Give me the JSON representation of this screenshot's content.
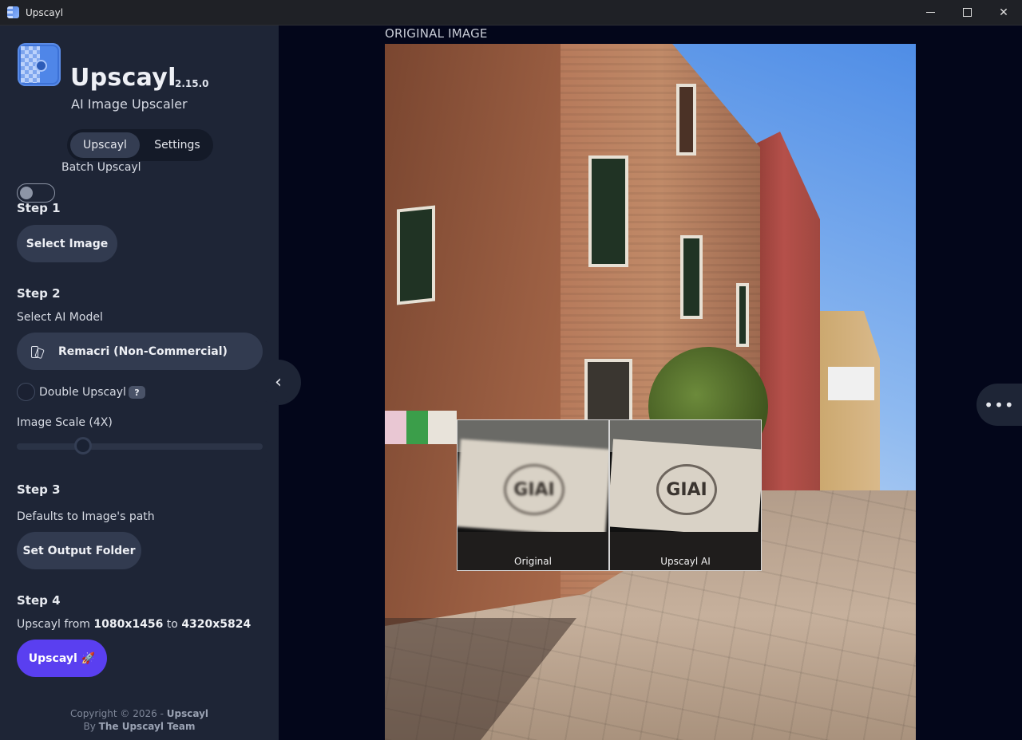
{
  "window": {
    "title": "Upscayl",
    "minimize_icon": "minimize-icon",
    "maximize_icon": "maximize-icon",
    "close_icon": "close-icon"
  },
  "sidebar": {
    "app_name": "Upscayl",
    "version": "2.15.0",
    "tagline": "AI Image Upscaler",
    "tabs": [
      {
        "label": "Upscayl",
        "active": true
      },
      {
        "label": "Settings",
        "active": false
      }
    ],
    "batch": {
      "label": "Batch Upscayl",
      "enabled": false
    },
    "step1": {
      "title": "Step 1",
      "button": "Select Image"
    },
    "step2": {
      "title": "Step 2",
      "model_label": "Select AI Model",
      "model_value": "Remacri (Non-Commercial)",
      "double_upscayl": {
        "label": "Double Upscayl",
        "help": "?",
        "checked": false
      },
      "scale_label": "Image Scale (4X)",
      "scale_fraction": 0.25
    },
    "step3": {
      "title": "Step 3",
      "description": "Defaults to Image's path",
      "button": "Set Output Folder"
    },
    "step4": {
      "title": "Step 4",
      "resolution_prefix": "Upscayl from",
      "from": "1080x1456",
      "to_word": "to",
      "to": "4320x5824",
      "button": "Upscayl",
      "button_emoji": "🚀"
    },
    "footer": {
      "copyright": "Copyright © 2026 -",
      "brand": "Upscayl",
      "by": "By",
      "team": "The Upscayl Team"
    }
  },
  "main": {
    "heading": "ORIGINAL IMAGE",
    "compare": {
      "left_label": "Original",
      "right_label": "Upscayl AI",
      "sign_text": "GIAI"
    },
    "collapse_icon": "chevron-left-icon",
    "more_icon": "more-horizontal-icon"
  },
  "colors": {
    "accent": "#5a3ff0",
    "sidebar_bg": "#1e2536",
    "main_bg": "#03061a"
  }
}
